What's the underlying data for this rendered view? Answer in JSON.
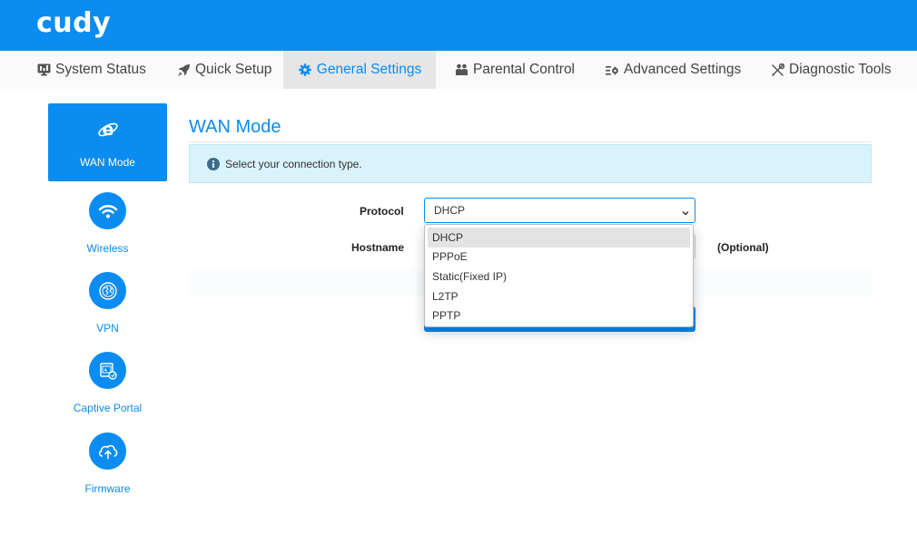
{
  "brand": {
    "logo": "cudy",
    "color": "#0a8cf0"
  },
  "nav": [
    {
      "label": "System Status",
      "icon": "monitor-icon"
    },
    {
      "label": "Quick Setup",
      "icon": "rocket-icon"
    },
    {
      "label": "General Settings",
      "icon": "gear-icon",
      "active": true
    },
    {
      "label": "Parental Control",
      "icon": "family-icon"
    },
    {
      "label": "Advanced Settings",
      "icon": "sliders-icon"
    },
    {
      "label": "Diagnostic Tools",
      "icon": "tools-icon"
    }
  ],
  "sidebar": [
    {
      "label": "WAN Mode",
      "icon": "internet-explorer-icon",
      "active": true
    },
    {
      "label": "Wireless",
      "icon": "wifi-icon"
    },
    {
      "label": "VPN",
      "icon": "globe-icon"
    },
    {
      "label": "Captive Portal",
      "icon": "portal-icon"
    },
    {
      "label": "Firmware",
      "icon": "cloud-upload-icon"
    }
  ],
  "main": {
    "title": "WAN Mode",
    "info": "Select your connection type.",
    "protocol": {
      "label": "Protocol",
      "value": "DHCP",
      "options": [
        "DHCP",
        "PPPoE",
        "Static(Fixed IP)",
        "L2TP",
        "PPTP"
      ]
    },
    "hostname": {
      "label": "Hostname",
      "value": "",
      "note": "(Optional)"
    }
  }
}
